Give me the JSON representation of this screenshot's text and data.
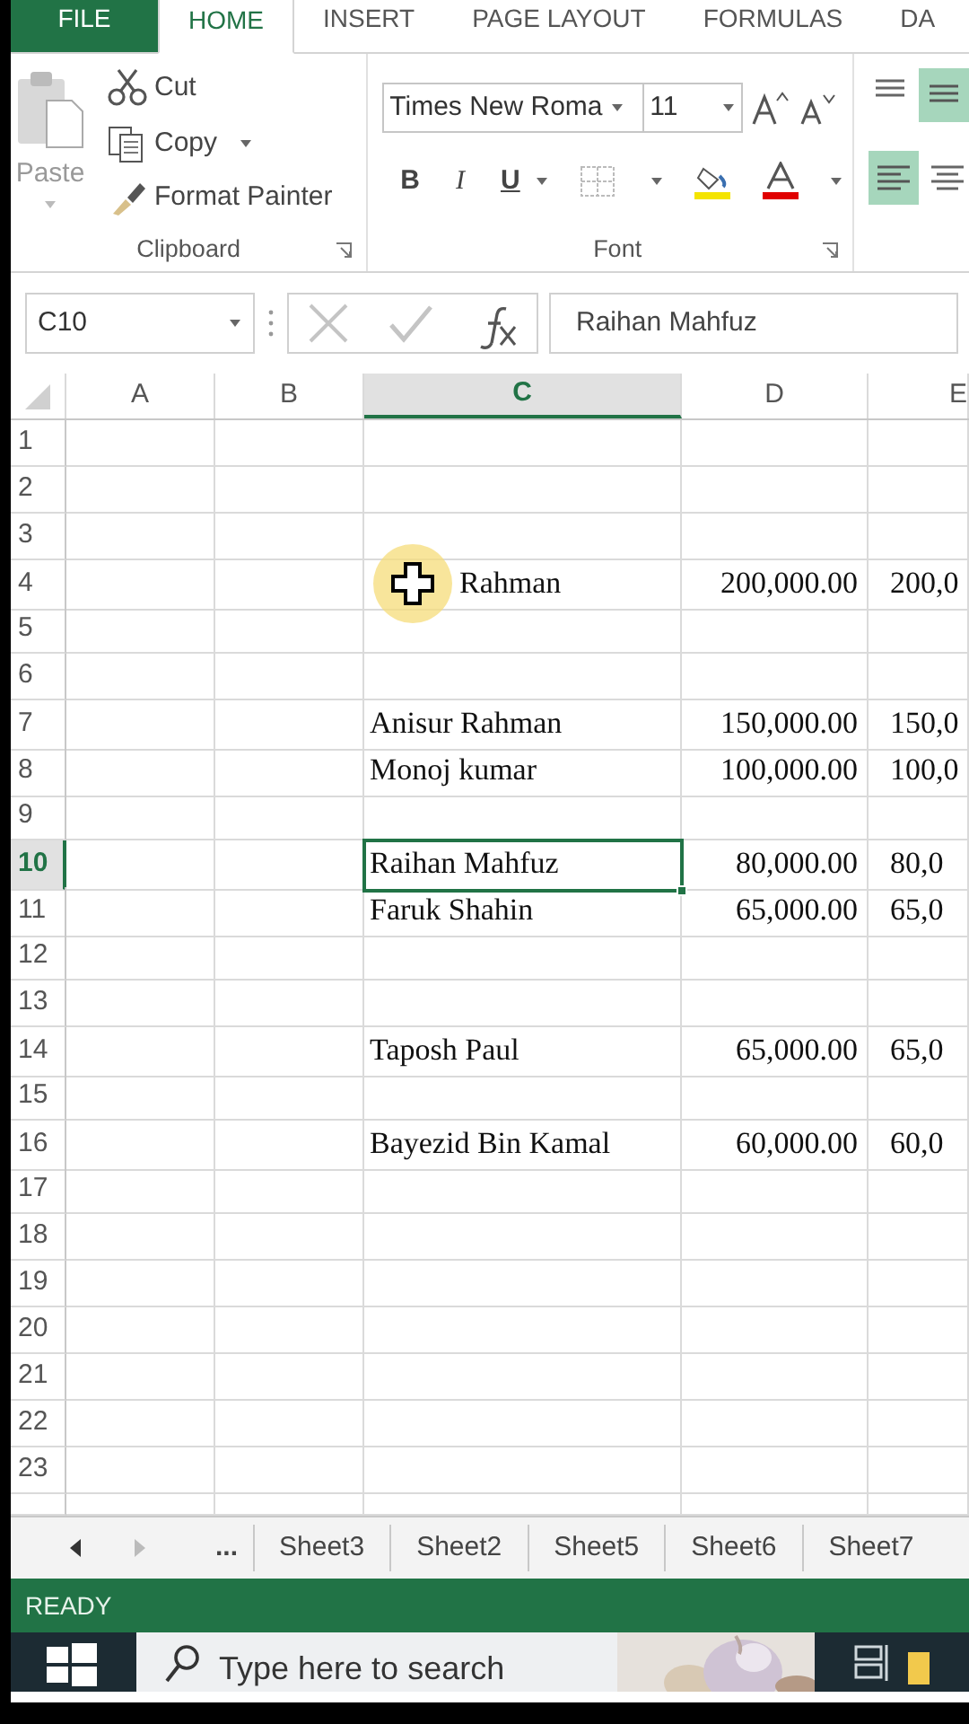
{
  "ribbon_tabs": [
    {
      "label": "FILE",
      "kind": "file",
      "selected": false
    },
    {
      "label": "HOME",
      "kind": "tab",
      "selected": true
    },
    {
      "label": "INSERT",
      "kind": "tab",
      "selected": false
    },
    {
      "label": "PAGE LAYOUT",
      "kind": "tab",
      "selected": false
    },
    {
      "label": "FORMULAS",
      "kind": "tab",
      "selected": false
    },
    {
      "label": "DA",
      "kind": "tab",
      "selected": false
    }
  ],
  "clipboard": {
    "paste": "Paste",
    "cut": "Cut",
    "copy": "Copy",
    "format_painter": "Format Painter",
    "label": "Clipboard"
  },
  "font": {
    "name": "Times New Roma",
    "size": "11",
    "bold": "B",
    "italic": "I",
    "underline": "U",
    "label": "Font"
  },
  "formula_bar": {
    "name_box": "C10",
    "formula": "Raihan Mahfuz"
  },
  "columns": [
    {
      "label": "A",
      "selected": false
    },
    {
      "label": "B",
      "selected": false
    },
    {
      "label": "C",
      "selected": true
    },
    {
      "label": "D",
      "selected": false
    },
    {
      "label": "E",
      "selected": false
    }
  ],
  "rows": [
    {
      "label": "1",
      "selected": false
    },
    {
      "label": "2",
      "selected": false
    },
    {
      "label": "3",
      "selected": false
    },
    {
      "label": "4",
      "selected": false,
      "name": "Rahman",
      "amount": "200,000.00",
      "amount_next": "200,0",
      "cursor": true
    },
    {
      "label": "5",
      "selected": false
    },
    {
      "label": "6",
      "selected": false
    },
    {
      "label": "7",
      "selected": false,
      "name": "Anisur Rahman",
      "amount": "150,000.00",
      "amount_next": "150,0"
    },
    {
      "label": "8",
      "selected": false,
      "name": "Monoj kumar",
      "amount": "100,000.00",
      "amount_next": "100,0"
    },
    {
      "label": "9",
      "selected": false
    },
    {
      "label": "10",
      "selected": true,
      "name": "Raihan Mahfuz",
      "amount": "80,000.00",
      "amount_next": "80,0"
    },
    {
      "label": "11",
      "selected": false,
      "name": "Faruk Shahin",
      "amount": "65,000.00",
      "amount_next": "65,0"
    },
    {
      "label": "12",
      "selected": false
    },
    {
      "label": "13",
      "selected": false
    },
    {
      "label": "14",
      "selected": false,
      "name": "Taposh Paul",
      "amount": "65,000.00",
      "amount_next": "65,0"
    },
    {
      "label": "15",
      "selected": false
    },
    {
      "label": "16",
      "selected": false,
      "name": "Bayezid Bin Kamal",
      "amount": "60,000.00",
      "amount_next": "60,0"
    },
    {
      "label": "17",
      "selected": false
    },
    {
      "label": "18",
      "selected": false
    },
    {
      "label": "19",
      "selected": false
    },
    {
      "label": "20",
      "selected": false
    },
    {
      "label": "21",
      "selected": false
    },
    {
      "label": "22",
      "selected": false
    },
    {
      "label": "23",
      "selected": false
    }
  ],
  "sheet_tabs": {
    "more": "...",
    "tabs": [
      "Sheet3",
      "Sheet2",
      "Sheet5",
      "Sheet6",
      "Sheet7"
    ]
  },
  "status_bar": {
    "text": "READY"
  },
  "taskbar": {
    "search_placeholder": "Type here to search"
  }
}
